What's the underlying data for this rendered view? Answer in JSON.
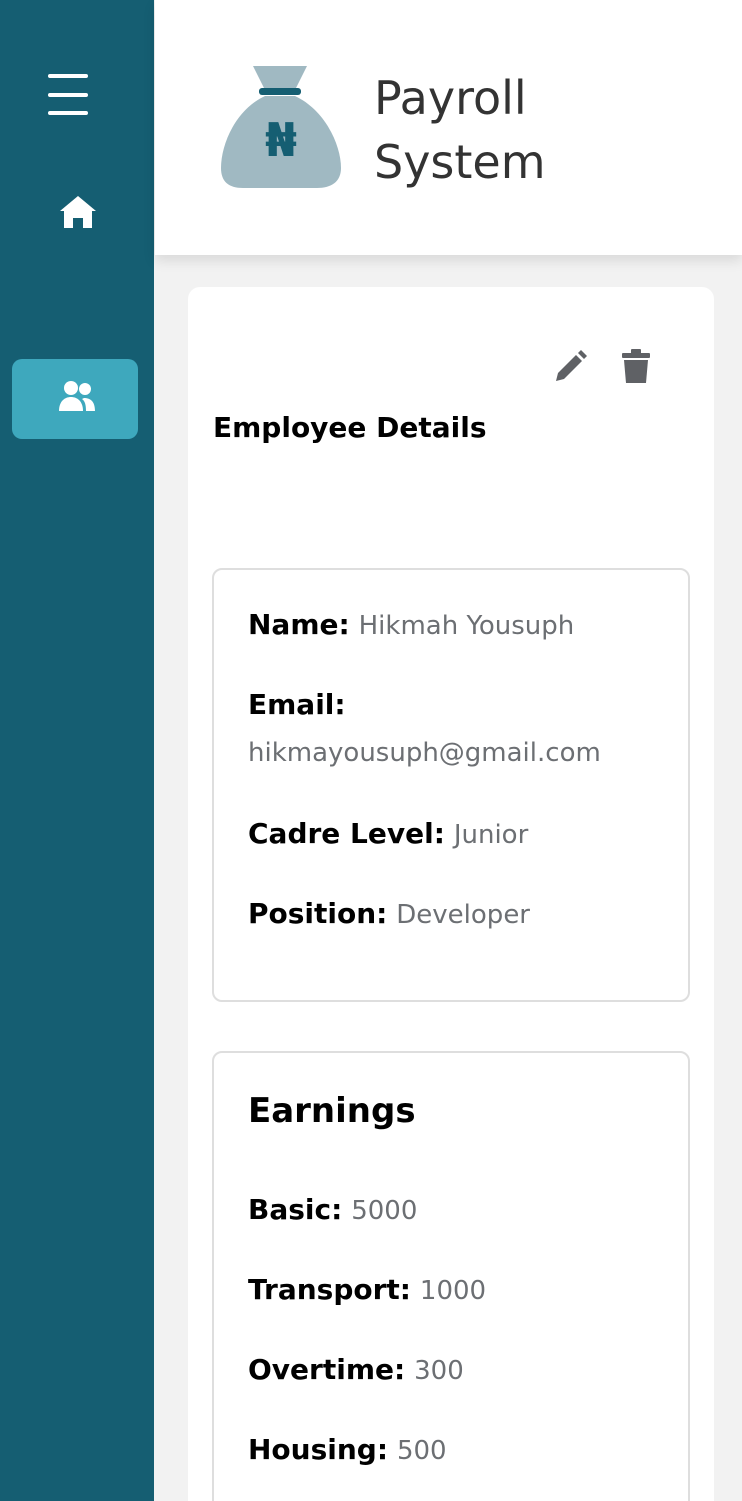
{
  "app": {
    "title_line1": "Payroll",
    "title_line2": "System"
  },
  "nav": {
    "menu_icon": "hamburger-icon",
    "home_icon": "home-icon",
    "users_icon": "users-icon",
    "active": "employees"
  },
  "colors": {
    "sidebar": "#155e72",
    "active_nav": "#3ea8bd",
    "logo_bag": "#a0b9c2",
    "logo_symbol": "#155e72",
    "value_text": "#6c6f73"
  },
  "logo": {
    "symbol": "₦",
    "icon": "money-bag-icon"
  },
  "actions": {
    "edit_icon": "pencil-icon",
    "delete_icon": "trash-icon"
  },
  "employee": {
    "heading": "Employee Details",
    "name_label": "Name:",
    "name": "Hikmah Yousuph",
    "email_label": "Email:",
    "email": "hikmayousuph@gmail.com",
    "cadre_label": "Cadre Level:",
    "cadre": "Junior",
    "position_label": "Position:",
    "position": "Developer"
  },
  "earnings": {
    "title": "Earnings",
    "items": [
      {
        "label": "Basic:",
        "value": "5000"
      },
      {
        "label": "Transport:",
        "value": "1000"
      },
      {
        "label": "Overtime:",
        "value": "300"
      },
      {
        "label": "Housing:",
        "value": "500"
      }
    ]
  }
}
